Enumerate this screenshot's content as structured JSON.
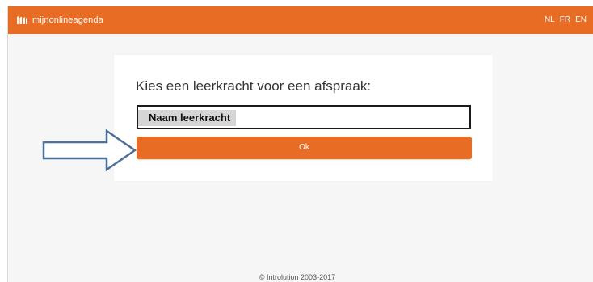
{
  "app": {
    "brand_name": "mijnonlineagenda",
    "brand_icon": "calendar-bars-icon",
    "accent_color": "#e96c25"
  },
  "languages": [
    "NL",
    "FR",
    "EN"
  ],
  "card": {
    "title": "Kies een leerkracht voor een afspraak:",
    "input_value": "Naam leerkracht",
    "ok_label": "Ok"
  },
  "annotation": {
    "arrow_icon": "right-arrow-outline-icon",
    "arrow_color": "#4a6f9a"
  },
  "footer": {
    "copyright": "© Introlution 2003-2017"
  }
}
